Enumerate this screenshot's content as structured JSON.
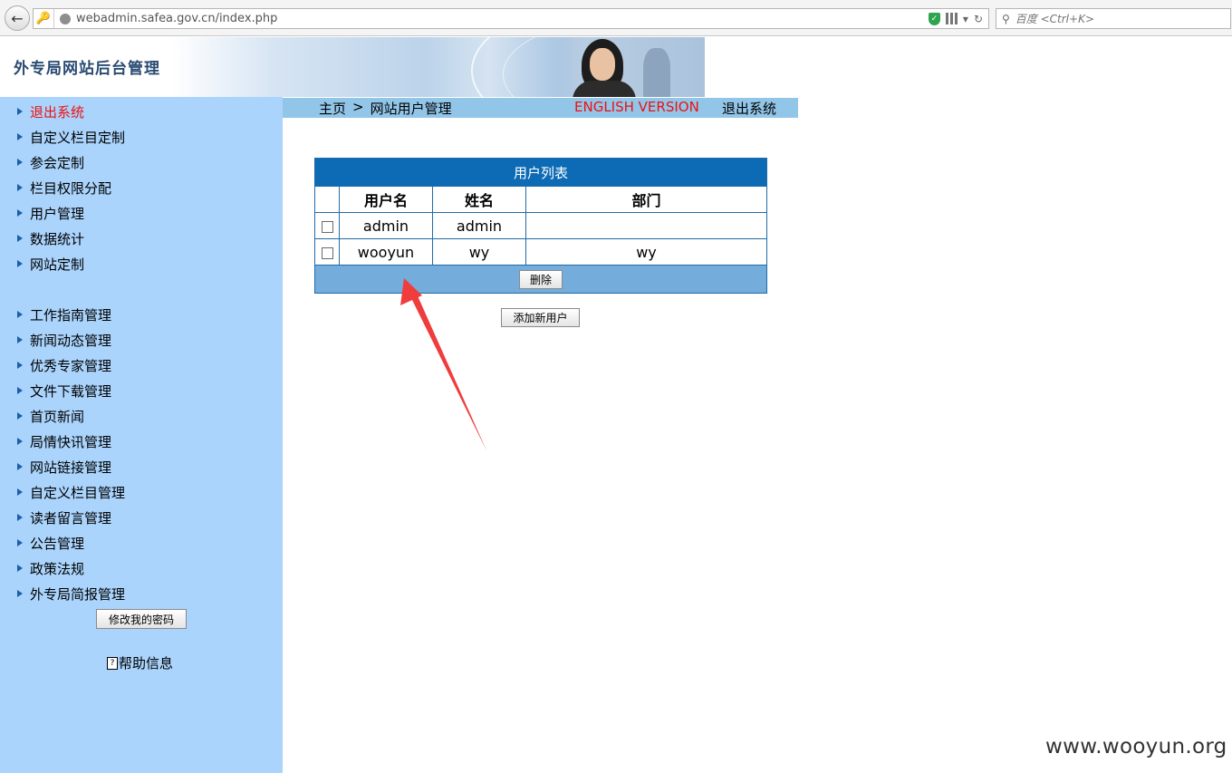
{
  "browser": {
    "url": "webadmin.safea.gov.cn/index.php",
    "search_placeholder": "百度 <Ctrl+K>"
  },
  "header": {
    "title": "外专局网站后台管理"
  },
  "sidebar": {
    "items": [
      {
        "label": "退出系统"
      },
      {
        "label": "自定义栏目定制"
      },
      {
        "label": "参会定制"
      },
      {
        "label": "栏目权限分配"
      },
      {
        "label": "用户管理"
      },
      {
        "label": "数据统计"
      },
      {
        "label": "网站定制"
      },
      {
        "label": "工作指南管理"
      },
      {
        "label": "新闻动态管理"
      },
      {
        "label": "优秀专家管理"
      },
      {
        "label": "文件下载管理"
      },
      {
        "label": "首页新闻"
      },
      {
        "label": "局情快讯管理"
      },
      {
        "label": "网站链接管理"
      },
      {
        "label": "自定义栏目管理"
      },
      {
        "label": "读者留言管理"
      },
      {
        "label": "公告管理"
      },
      {
        "label": "政策法规"
      },
      {
        "label": "外专局简报管理"
      }
    ],
    "change_password_label": "修改我的密码",
    "help_label": "帮助信息",
    "help_icon_glyph": "?"
  },
  "navbar": {
    "home": "主页",
    "separator": ">",
    "current": "网站用户管理",
    "english": "ENGLISH VERSION",
    "logout": "退出系统"
  },
  "table": {
    "caption": "用户列表",
    "columns": [
      "用户名",
      "姓名",
      "部门"
    ],
    "rows": [
      {
        "username": "admin",
        "name": "admin",
        "department": ""
      },
      {
        "username": "wooyun",
        "name": "wy",
        "department": "wy"
      }
    ],
    "delete_label": "删除"
  },
  "add_user_label": "添加新用户",
  "watermark": "www.wooyun.org",
  "colors": {
    "sidebar_bg": "#aad4fc",
    "navbar_bg": "#92c6e9",
    "table_caption_bg": "#0d6bb5",
    "table_footer_bg": "#74acdb",
    "accent_red": "#ee1111",
    "arrow_red": "#f03c3c"
  }
}
